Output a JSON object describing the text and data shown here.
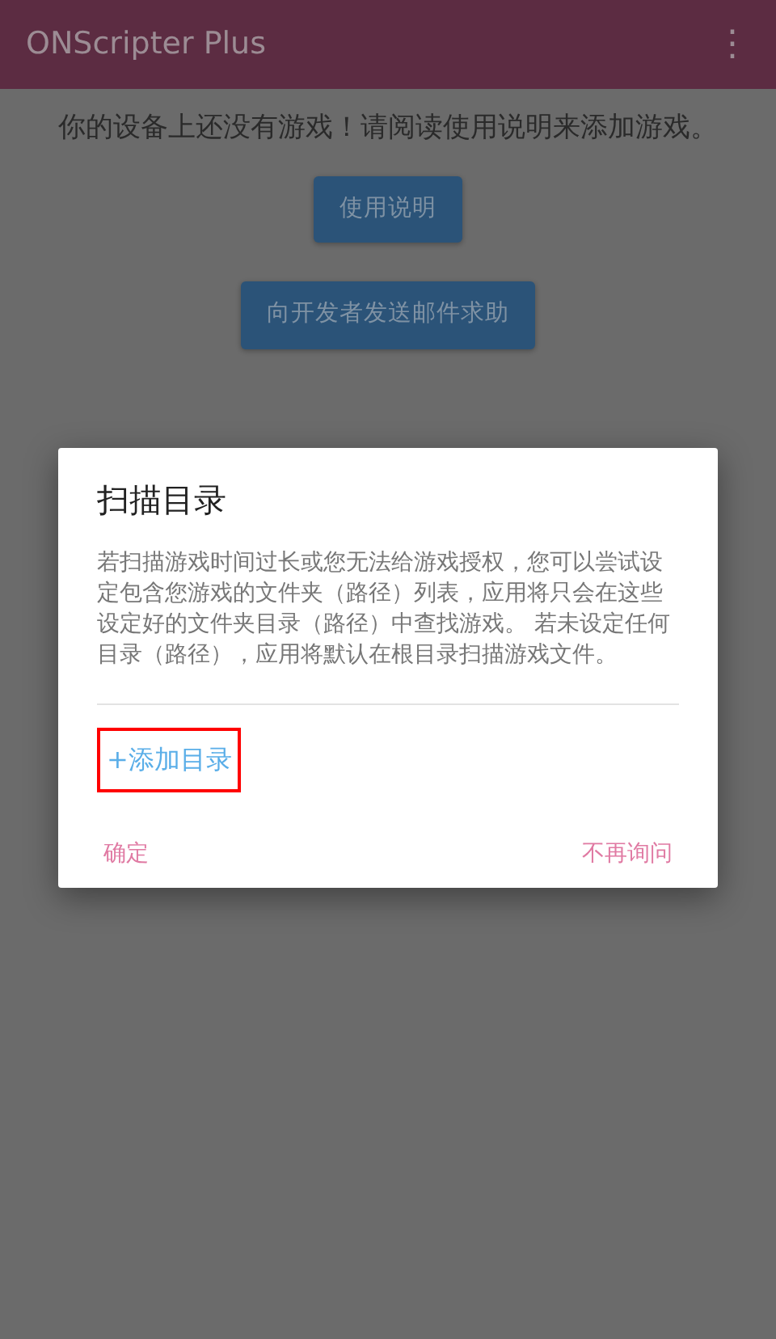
{
  "app_bar": {
    "title": "ONScripter Plus",
    "menu_icon": "⋮"
  },
  "main": {
    "message": "你的设备上还没有游戏！请阅读使用说明来添加游戏。",
    "buttons": [
      "使用说明",
      "向开发者发送邮件求助"
    ]
  },
  "dialog": {
    "title": "扫描目录",
    "body": "若扫描游戏时间过长或您无法给游戏授权，您可以尝试设定包含您游戏的文件夹（路径）列表，应用将只会在这些设定好的文件夹目录（路径）中查找游戏。 若未设定任何目录（路径），应用将默认在根目录扫描游戏文件。",
    "add_button": {
      "label": "+添加目录",
      "highlighted": true
    },
    "actions": [
      "确定",
      "不再询问"
    ]
  }
}
